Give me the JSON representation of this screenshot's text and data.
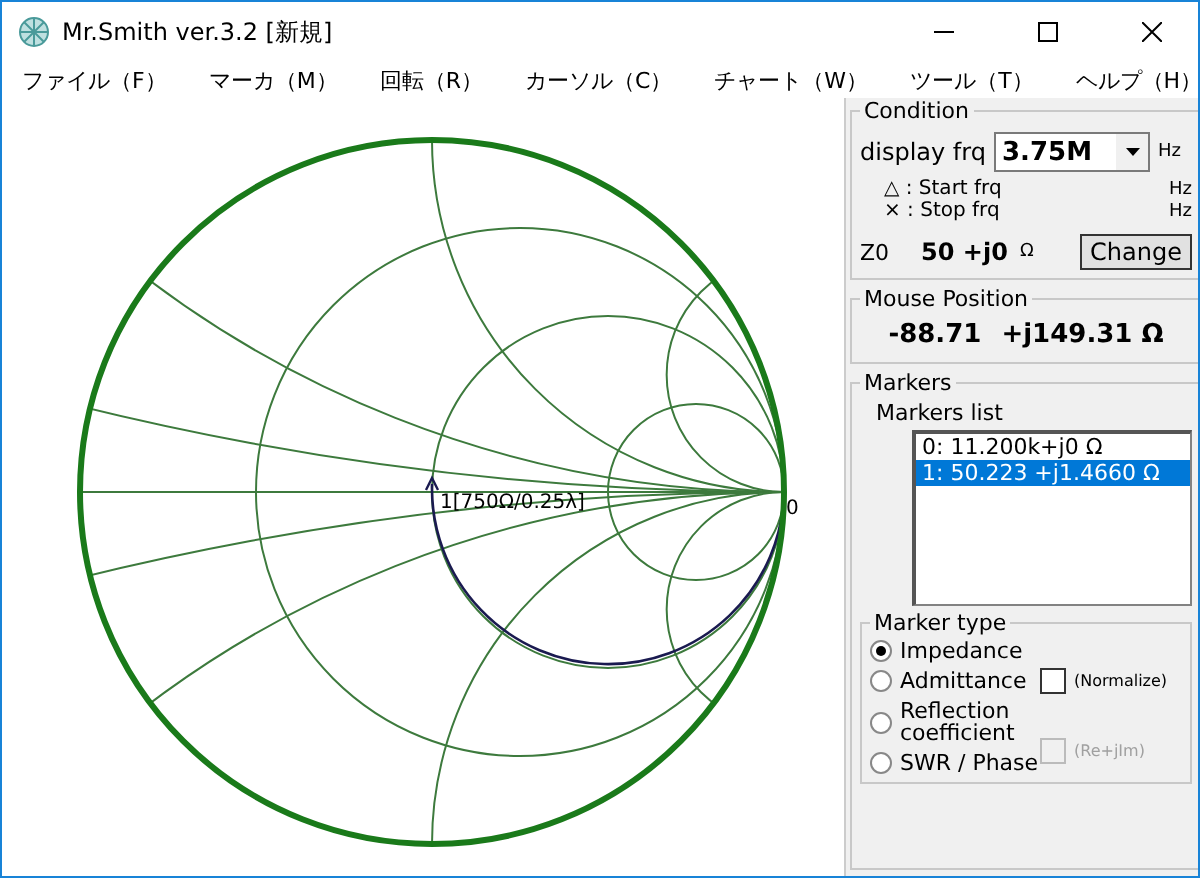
{
  "window": {
    "title": "Mr.Smith ver.3.2 [新規]"
  },
  "menu": [
    "ファイル（F）",
    "マーカ（M）",
    "回転（R）",
    "カーソル（C）",
    "チャート（W）",
    "ツール（T）",
    "ヘルプ（H）"
  ],
  "chart": {
    "marker_label": "1[750Ω/0.25λ]",
    "origin_label": "0"
  },
  "condition": {
    "title": "Condition",
    "display_label": "display frq",
    "display_value": "3.75M",
    "display_unit": "Hz",
    "start_label": "△ : Start frq",
    "start_unit": "Hz",
    "stop_label": "× : Stop frq",
    "stop_unit": "Hz",
    "z0_label": "Z0",
    "z0_value": "50 +j0",
    "z0_unit": "Ω",
    "change_button": "Change"
  },
  "mouse_position": {
    "title": "Mouse Position",
    "real": "-88.71",
    "imag": "+j149.31 Ω"
  },
  "markers": {
    "title": "Markers",
    "list_label": "Markers list",
    "items": [
      {
        "text": "0: 11.200k+j0 Ω",
        "selected": false
      },
      {
        "text": "1: 50.223 +j1.4660 Ω",
        "selected": true
      }
    ],
    "marker_type": {
      "title": "Marker type",
      "options": [
        {
          "label": "Impedance",
          "selected": true
        },
        {
          "label": "Admittance",
          "selected": false
        },
        {
          "label": "Reflection coefficient",
          "selected": false
        },
        {
          "label": "SWR / Phase",
          "selected": false
        }
      ],
      "normalize": {
        "label": "(Normalize)",
        "checked": false,
        "disabled": false
      },
      "re_im": {
        "label": "(Re+jIm)",
        "checked": false,
        "disabled": true
      }
    }
  }
}
